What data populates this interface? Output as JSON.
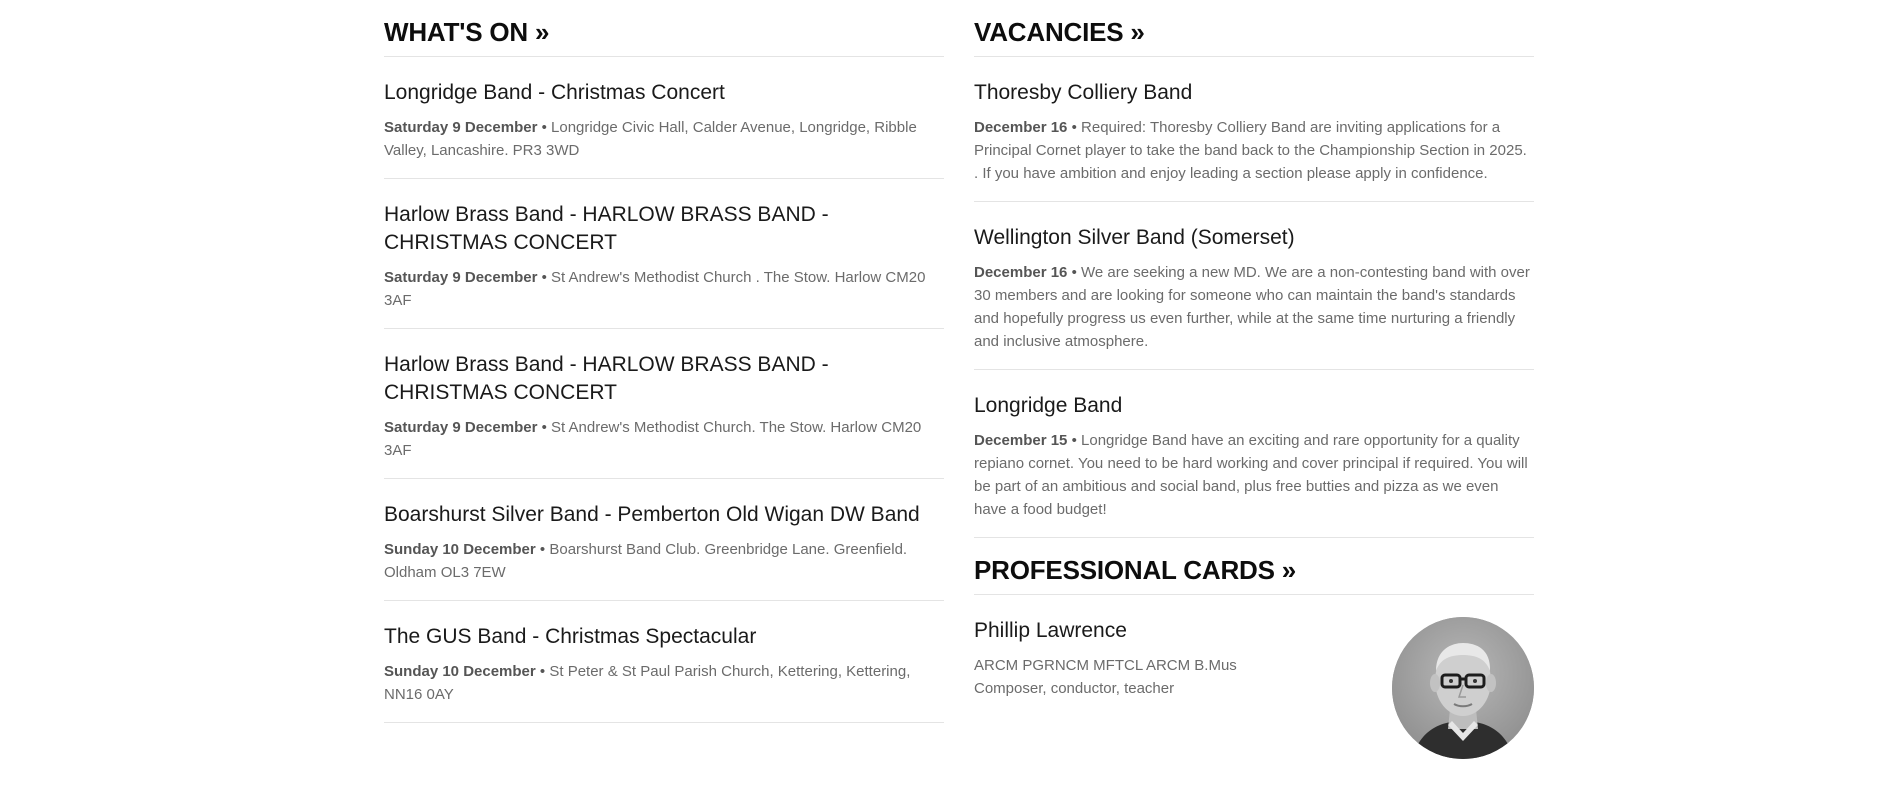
{
  "whats_on": {
    "heading": "WHAT'S ON »",
    "events": [
      {
        "title": "Longridge Band - Christmas Concert",
        "date": "Saturday 9 December",
        "location": "Longridge Civic Hall, Calder Avenue, Longridge, Ribble Valley, Lancashire. PR3 3WD"
      },
      {
        "title": "Harlow Brass Band - HARLOW BRASS BAND - CHRISTMAS CONCERT",
        "date": "Saturday 9 December",
        "location": "St Andrew's Methodist Church . The Stow. Harlow CM20 3AF"
      },
      {
        "title": "Harlow Brass Band - HARLOW BRASS BAND - CHRISTMAS CONCERT",
        "date": "Saturday 9 December",
        "location": "St Andrew's Methodist Church. The Stow. Harlow CM20 3AF"
      },
      {
        "title": "Boarshurst Silver Band - Pemberton Old Wigan DW Band",
        "date": "Sunday 10 December",
        "location": "Boarshurst Band Club. Greenbridge Lane. Greenfield. Oldham OL3 7EW"
      },
      {
        "title": "The GUS Band - Christmas Spectacular",
        "date": "Sunday 10 December",
        "location": "St Peter & St Paul Parish Church, Kettering, Kettering, NN16 0AY"
      }
    ]
  },
  "vacancies": {
    "heading": "VACANCIES »",
    "items": [
      {
        "title": "Thoresby Colliery Band",
        "date": "December 16",
        "text": "Required: Thoresby Colliery Band are inviting applications for a Principal Cornet player to take the band back to the Championship Section in 2025. . If you have ambition and enjoy leading a section please apply in confidence."
      },
      {
        "title": "Wellington Silver Band (Somerset)",
        "date": "December 16",
        "text": "We are seeking a new MD. We are a non-contesting band with over 30 members and are looking for someone who can maintain the band's standards and hopefully progress us even further, while at the same time nurturing a friendly and inclusive atmosphere."
      },
      {
        "title": "Longridge Band",
        "date": "December 15",
        "text": "Longridge Band have an exciting and rare opportunity for a quality repiano cornet. You need to be hard working and cover principal if required. You will be part of an ambitious and social band, plus free butties and pizza as we even have a food budget!"
      }
    ]
  },
  "professional_cards": {
    "heading": "PROFESSIONAL CARDS »",
    "card": {
      "name": "Phillip Lawrence",
      "qualifications": "ARCM PGRNCM MFTCL ARCM B.Mus",
      "roles": "Composer, conductor, teacher"
    }
  },
  "separator": "•"
}
